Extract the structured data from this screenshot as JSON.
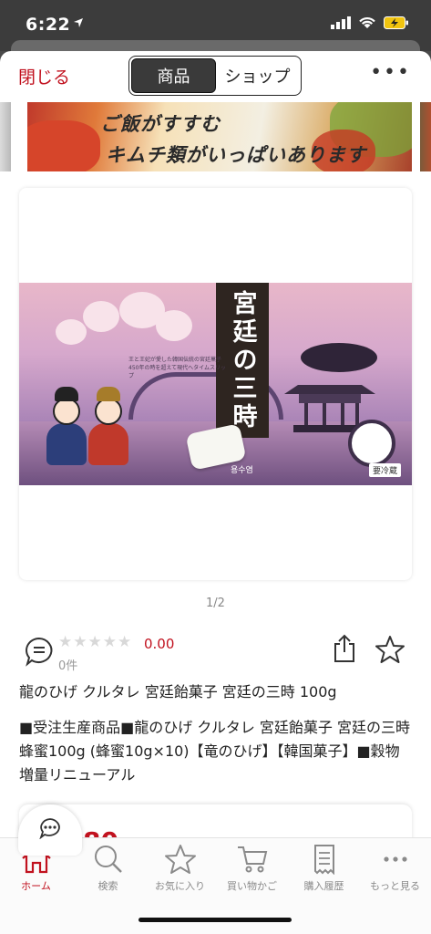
{
  "status_bar": {
    "time": "6:22"
  },
  "topbar": {
    "close_label": "閉じる",
    "segments": [
      {
        "label": "商品",
        "active": true
      },
      {
        "label": "ショップ",
        "active": false
      }
    ],
    "more_icon": "ellipsis-icon"
  },
  "banner": {
    "line1": "ご飯がすすむ",
    "line2": "キムチ類がいっぱいあります"
  },
  "product_image": {
    "title": "宮廷の三時",
    "subtitle": "王と王妃が愛した韓国伝統の宮廷菓子 450年の時を超えて現代へタイムスリップ",
    "brand": "용수염",
    "chilled_label": "要冷蔵"
  },
  "pager": "1/2",
  "rating": {
    "value": "0.00",
    "stars": "★★★★★",
    "review_count": "0件"
  },
  "product": {
    "title": "龍のひげ クルタレ 宮廷飴菓子 宮廷の三時 100g",
    "description": "■受注生産商品■龍のひげ クルタレ 宮廷飴菓子 宮廷の三時 蜂蜜100g (蜂蜜10g×10)【竜のひげ】【韓国菓子】■穀物増量リニューアル",
    "price_partial": "80"
  },
  "bottom_nav": [
    {
      "label": "ホーム",
      "icon": "home-icon",
      "active": true
    },
    {
      "label": "検索",
      "icon": "search-icon",
      "active": false
    },
    {
      "label": "お気に入り",
      "icon": "star-icon",
      "active": false
    },
    {
      "label": "買い物かご",
      "icon": "cart-icon",
      "active": false
    },
    {
      "label": "購入履歴",
      "icon": "receipt-icon",
      "active": false
    },
    {
      "label": "もっと見る",
      "icon": "more-icon",
      "active": false
    }
  ],
  "colors": {
    "accent": "#c1121f",
    "inactive": "#8a8a8a"
  }
}
